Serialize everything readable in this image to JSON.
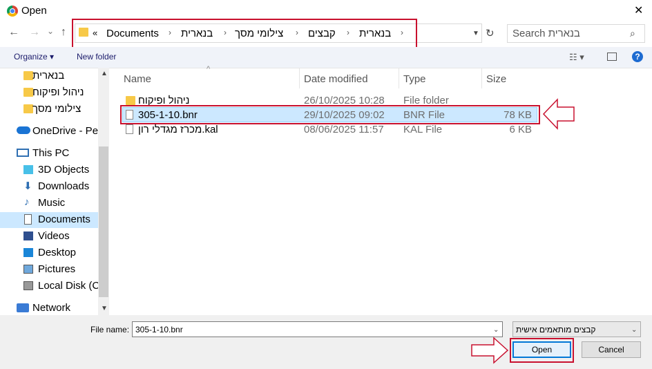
{
  "window": {
    "title": "Open",
    "close_glyph": "✕"
  },
  "nav": {
    "back_glyph": "←",
    "forward_glyph": "→",
    "recent_glyph": "⌄",
    "up_glyph": "↑",
    "chevron_glyph": "«",
    "crumbs": [
      "Documents",
      "בנארית",
      "צילומי מסך",
      "קבצים",
      "בנארית"
    ],
    "sep_glyph": "›",
    "refresh_glyph": "↻"
  },
  "search": {
    "placeholder": "Search בנארית",
    "icon": "search-icon"
  },
  "toolbar": {
    "organize_label": "Organize ▾",
    "new_folder_label": "New folder",
    "view_glyph": "☷ ▾",
    "help_glyph": "?"
  },
  "sidebar": {
    "items": [
      {
        "label": "בנארית",
        "icon": "folder-icon"
      },
      {
        "label": "ניהול ופיקוח",
        "icon": "folder-icon"
      },
      {
        "label": "צילומי מסך",
        "icon": "folder-icon"
      },
      {
        "label": "OneDrive - Pe",
        "icon": "cloud-icon"
      },
      {
        "label": "This PC",
        "icon": "monitor-icon"
      },
      {
        "label": "3D Objects",
        "icon": "cube-icon"
      },
      {
        "label": "Downloads",
        "icon": "download-icon"
      },
      {
        "label": "Music",
        "icon": "music-icon"
      },
      {
        "label": "Documents",
        "icon": "document-icon",
        "selected": true
      },
      {
        "label": "Videos",
        "icon": "video-icon"
      },
      {
        "label": "Desktop",
        "icon": "desktop-icon"
      },
      {
        "label": "Pictures",
        "icon": "picture-icon"
      },
      {
        "label": "Local Disk (C",
        "icon": "disk-icon"
      },
      {
        "label": "Network",
        "icon": "network-icon"
      }
    ]
  },
  "columns": {
    "name": "Name",
    "date": "Date modified",
    "type": "Type",
    "size": "Size",
    "sort_glyph": "^"
  },
  "files": [
    {
      "name": "ניהול ופיקוח",
      "date": "26/10/2025 10:28",
      "type": "File folder",
      "size": "",
      "icon": "folder-icon"
    },
    {
      "name": "305-1-10.bnr",
      "date": "29/10/2025 09:02",
      "type": "BNR File",
      "size": "78 KB",
      "icon": "file-icon",
      "selected": true
    },
    {
      "name": "מכרז מגדלי רון.kal",
      "date": "08/06/2025 11:57",
      "type": "KAL File",
      "size": "6 KB",
      "icon": "file-icon"
    }
  ],
  "bottom": {
    "filename_label": "File name:",
    "filename_value": "305-1-10.bnr",
    "filetype_value": "קבצים מותאמים אישית",
    "open_label": "Open",
    "cancel_label": "Cancel"
  },
  "colors": {
    "annotation_red": "#c8102e",
    "selection": "#cce8ff",
    "open_border": "#0078d7"
  }
}
